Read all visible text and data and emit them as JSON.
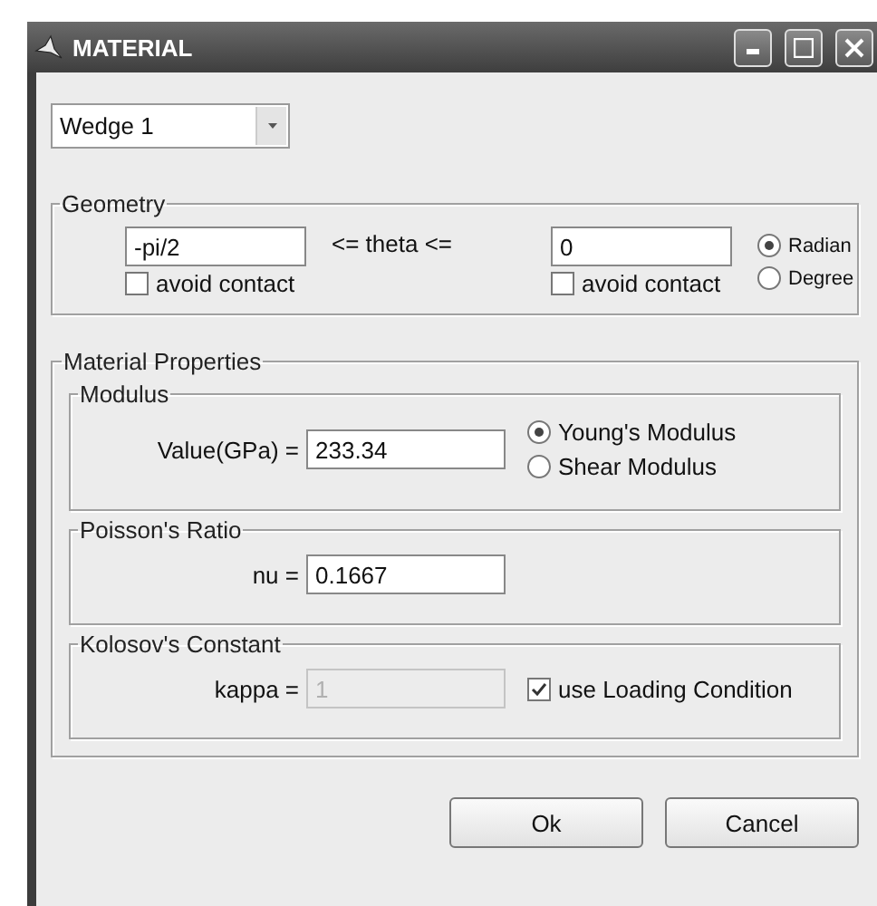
{
  "window": {
    "title": "MATERIAL"
  },
  "selector": {
    "value": "Wedge 1"
  },
  "geometry": {
    "title": "Geometry",
    "relation": "<= theta <=",
    "bounds": [
      {
        "value": "-pi/2",
        "checkbox": {
          "label": "avoid contact",
          "checked": false
        }
      },
      {
        "value": "0",
        "checkbox": {
          "label": "avoid contact",
          "checked": false
        }
      }
    ],
    "units": [
      {
        "label": "Radian",
        "selected": true
      },
      {
        "label": "Degree",
        "selected": false
      }
    ]
  },
  "material": {
    "title": "Material Properties",
    "groups": [
      {
        "title": "Modulus",
        "label": "Value(GPa) =",
        "value": "233.34",
        "disabled": false,
        "options": [
          {
            "label": "Young's Modulus",
            "selected": true
          },
          {
            "label": "Shear Modulus",
            "selected": false
          }
        ]
      },
      {
        "title": "Poisson's Ratio",
        "label": "nu =",
        "value": "0.1667",
        "disabled": false
      },
      {
        "title": "Kolosov's Constant",
        "label": "kappa =",
        "value": "1",
        "disabled": true,
        "checkbox": {
          "label": "use Loading Condition",
          "checked": true
        }
      }
    ]
  },
  "buttons": [
    "Ok",
    "Cancel"
  ]
}
